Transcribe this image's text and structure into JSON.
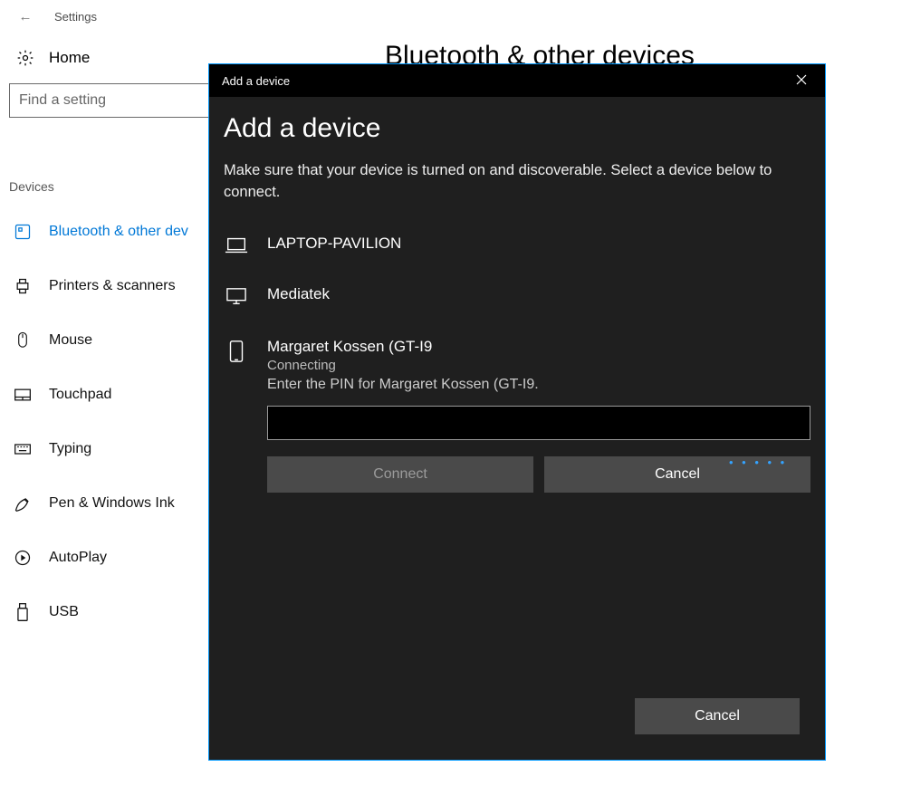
{
  "window": {
    "back_label": "←",
    "title": "Settings"
  },
  "home": {
    "label": "Home"
  },
  "search": {
    "placeholder": "Find a setting"
  },
  "sidebar": {
    "heading": "Devices",
    "items": [
      {
        "label": "Bluetooth & other dev",
        "icon": "bluetooth-tile-icon",
        "active": true
      },
      {
        "label": "Printers & scanners",
        "icon": "printer-icon"
      },
      {
        "label": "Mouse",
        "icon": "mouse-icon"
      },
      {
        "label": "Touchpad",
        "icon": "touchpad-icon"
      },
      {
        "label": "Typing",
        "icon": "keyboard-icon"
      },
      {
        "label": "Pen & Windows Ink",
        "icon": "pen-icon"
      },
      {
        "label": "AutoPlay",
        "icon": "autoplay-icon"
      },
      {
        "label": "USB",
        "icon": "usb-icon"
      }
    ]
  },
  "page": {
    "title": "Bluetooth & other devices"
  },
  "modal": {
    "bar_title": "Add a device",
    "heading": "Add a device",
    "subtext": "Make sure that your device is turned on and discoverable. Select a device below to connect.",
    "devices": [
      {
        "name": "LAPTOP-PAVILION",
        "icon": "laptop-icon"
      },
      {
        "name": "Mediatek",
        "icon": "desktop-icon"
      }
    ],
    "connecting": {
      "name": "Margaret Kossen (GT-I9",
      "status": "Connecting",
      "pin_prompt": "Enter the PIN for Margaret Kossen (GT-I9.",
      "connect_label": "Connect",
      "cancel_label": "Cancel",
      "icon": "phone-icon"
    },
    "footer_cancel": "Cancel"
  }
}
